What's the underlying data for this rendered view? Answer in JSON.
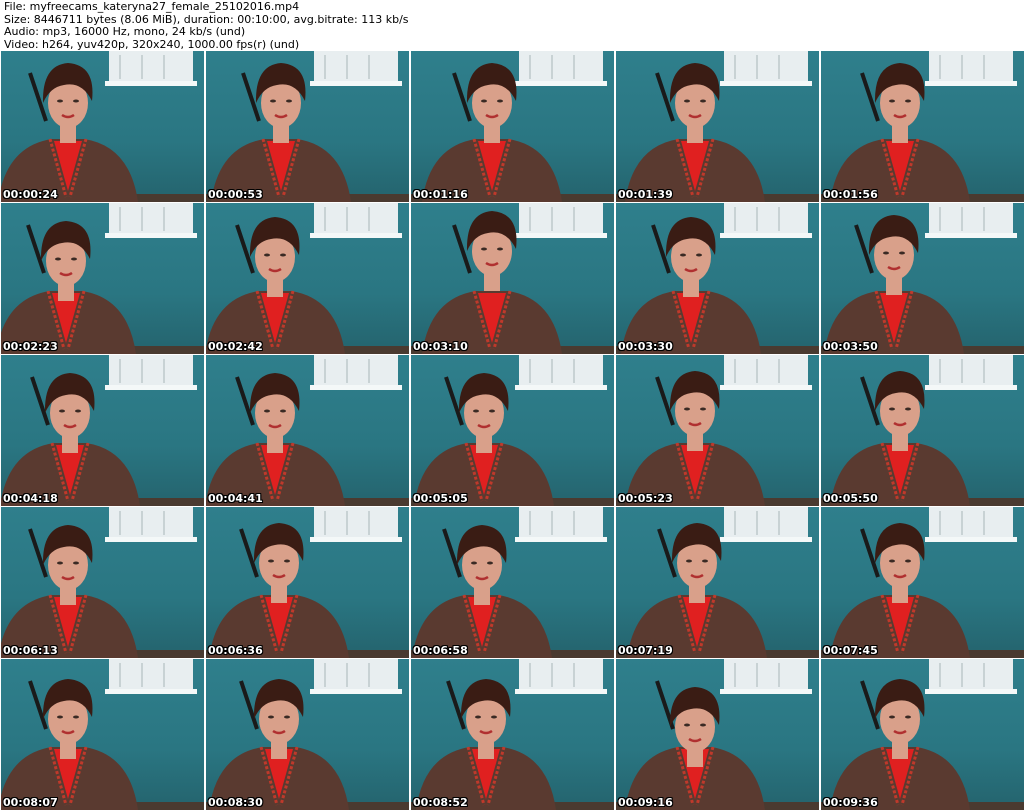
{
  "header": {
    "file": "File: myfreecams_kateryna27_female_25102016.mp4",
    "size": "Size: 8446711 bytes (8.06 MiB), duration: 00:10:00, avg.bitrate: 113 kb/s",
    "audio": "Audio: mp3, 16000 Hz, mono, 24 kb/s (und)",
    "video": "Video: h264, yuv420p, 320x240, 1000.00 fps(r) (und)"
  },
  "colors": {
    "wall": "#2f7f8c",
    "sweater": "#5a3a30",
    "hair": "#3a1c14",
    "skin": "#d9a08a",
    "shirt": "#e02020",
    "shelf": "#e8eef0"
  },
  "thumbnails": [
    {
      "timestamp": "00:00:24",
      "image": "webcam-frame"
    },
    {
      "timestamp": "00:00:53",
      "image": "webcam-frame"
    },
    {
      "timestamp": "00:01:16",
      "image": "webcam-frame"
    },
    {
      "timestamp": "00:01:39",
      "image": "webcam-frame"
    },
    {
      "timestamp": "00:01:56",
      "image": "webcam-frame"
    },
    {
      "timestamp": "00:02:23",
      "image": "webcam-frame"
    },
    {
      "timestamp": "00:02:42",
      "image": "webcam-frame"
    },
    {
      "timestamp": "00:03:10",
      "image": "webcam-frame"
    },
    {
      "timestamp": "00:03:30",
      "image": "webcam-frame"
    },
    {
      "timestamp": "00:03:50",
      "image": "webcam-frame"
    },
    {
      "timestamp": "00:04:18",
      "image": "webcam-frame"
    },
    {
      "timestamp": "00:04:41",
      "image": "webcam-frame"
    },
    {
      "timestamp": "00:05:05",
      "image": "webcam-frame"
    },
    {
      "timestamp": "00:05:23",
      "image": "webcam-frame"
    },
    {
      "timestamp": "00:05:50",
      "image": "webcam-frame"
    },
    {
      "timestamp": "00:06:13",
      "image": "webcam-frame"
    },
    {
      "timestamp": "00:06:36",
      "image": "webcam-frame"
    },
    {
      "timestamp": "00:06:58",
      "image": "webcam-frame"
    },
    {
      "timestamp": "00:07:19",
      "image": "webcam-frame"
    },
    {
      "timestamp": "00:07:45",
      "image": "webcam-frame"
    },
    {
      "timestamp": "00:08:07",
      "image": "webcam-frame"
    },
    {
      "timestamp": "00:08:30",
      "image": "webcam-frame"
    },
    {
      "timestamp": "00:08:52",
      "image": "webcam-frame"
    },
    {
      "timestamp": "00:09:16",
      "image": "webcam-frame"
    },
    {
      "timestamp": "00:09:36",
      "image": "webcam-frame"
    }
  ]
}
